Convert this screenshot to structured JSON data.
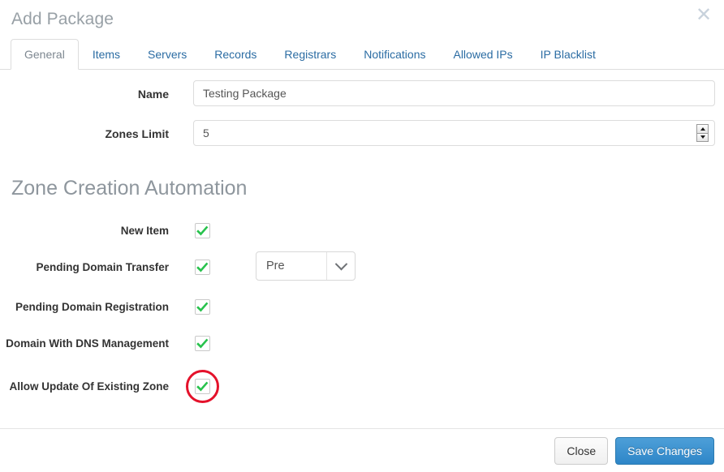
{
  "dialog": {
    "title": "Add Package",
    "close_icon": "close-icon"
  },
  "tabs": [
    {
      "label": "General",
      "active": true
    },
    {
      "label": "Items",
      "active": false
    },
    {
      "label": "Servers",
      "active": false
    },
    {
      "label": "Records",
      "active": false
    },
    {
      "label": "Registrars",
      "active": false
    },
    {
      "label": "Notifications",
      "active": false
    },
    {
      "label": "Allowed IPs",
      "active": false
    },
    {
      "label": "IP Blacklist",
      "active": false
    }
  ],
  "form": {
    "name": {
      "label": "Name",
      "value": "Testing Package",
      "placeholder": "Name"
    },
    "zones_limit": {
      "label": "Zones Limit",
      "value": "5",
      "placeholder": "Zones Limit"
    }
  },
  "automation": {
    "section_title": "Zone Creation Automation",
    "rows": [
      {
        "label": "New Item",
        "checked": true,
        "has_select": false,
        "highlighted": false
      },
      {
        "label": "Pending Domain Transfer",
        "checked": true,
        "has_select": true,
        "select_value": "Pre",
        "highlighted": false
      },
      {
        "label": "Pending Domain Registration",
        "checked": true,
        "has_select": false,
        "highlighted": false
      },
      {
        "label": "Domain With DNS Management",
        "checked": true,
        "has_select": false,
        "highlighted": false
      },
      {
        "label": "Allow Update Of Existing Zone",
        "checked": true,
        "has_select": false,
        "highlighted": true
      }
    ]
  },
  "footer": {
    "close_label": "Close",
    "save_label": "Save Changes"
  },
  "colors": {
    "tab_link": "#2b6ca3",
    "primary_button": "#2e86c8",
    "check_green": "#27c24c",
    "highlight_red": "#e4122b",
    "title_gray": "#98a0a6"
  }
}
